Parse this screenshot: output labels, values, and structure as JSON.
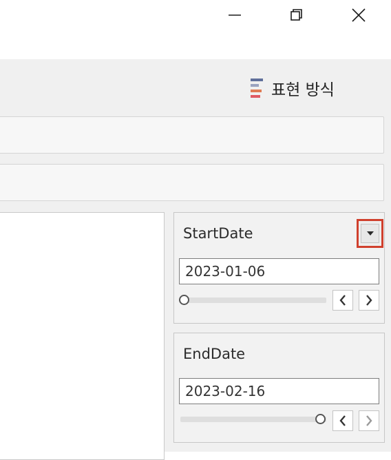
{
  "window": {
    "controls": [
      {
        "name": "minimize-button",
        "icon": "minimize-icon"
      },
      {
        "name": "restore-button",
        "icon": "restore-icon"
      },
      {
        "name": "close-button",
        "icon": "close-icon"
      }
    ]
  },
  "toolbar": {
    "show_me_label": "표현 방식",
    "show_me_icon": "show-me-bars-icon"
  },
  "filters": {
    "start_date": {
      "title": "StartDate",
      "value": "2023-01-06",
      "slider_position": 0.0,
      "dropdown_icon": "chevron-down-icon"
    },
    "end_date": {
      "title": "EndDate",
      "value": "2023-02-16",
      "slider_position": 1.0
    }
  },
  "colors": {
    "highlight_border": "#d0402d",
    "show_me_bar_1": "#5f6f9a",
    "show_me_bar_2": "#9aa3c0",
    "show_me_bar_3": "#e07b53",
    "show_me_bar_4": "#e05a63"
  }
}
